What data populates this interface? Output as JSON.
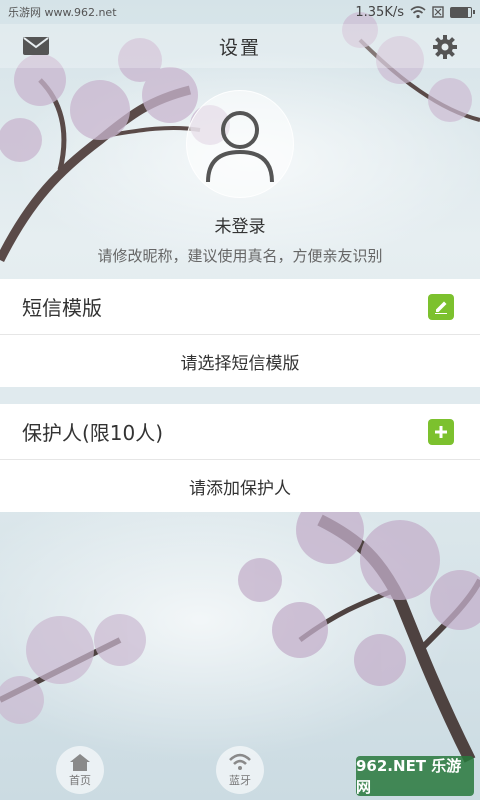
{
  "status_bar": {
    "site_label": "乐游网 www.962.net",
    "speed": "1.35K/s"
  },
  "header": {
    "title": "设置",
    "icons": {
      "left": "mail-icon",
      "right": "gear-icon"
    }
  },
  "profile": {
    "status": "未登录",
    "hint": "请修改昵称，建议使用真名，方便亲友识别"
  },
  "sms_template": {
    "title": "短信模版",
    "placeholder": "请选择短信模版",
    "action_icon": "edit-icon"
  },
  "guardian": {
    "title": "保护人(限10人)",
    "placeholder": "请添加保护人",
    "action_icon": "add-icon"
  },
  "bottom_nav": [
    {
      "label": "首页",
      "icon": "home-icon"
    },
    {
      "label": "蓝牙",
      "icon": "bluetooth-signal-icon"
    }
  ],
  "watermark": {
    "text": "962.NET 乐游网"
  },
  "colors": {
    "accent": "#7cc12e",
    "card_bg": "#ffffff"
  }
}
